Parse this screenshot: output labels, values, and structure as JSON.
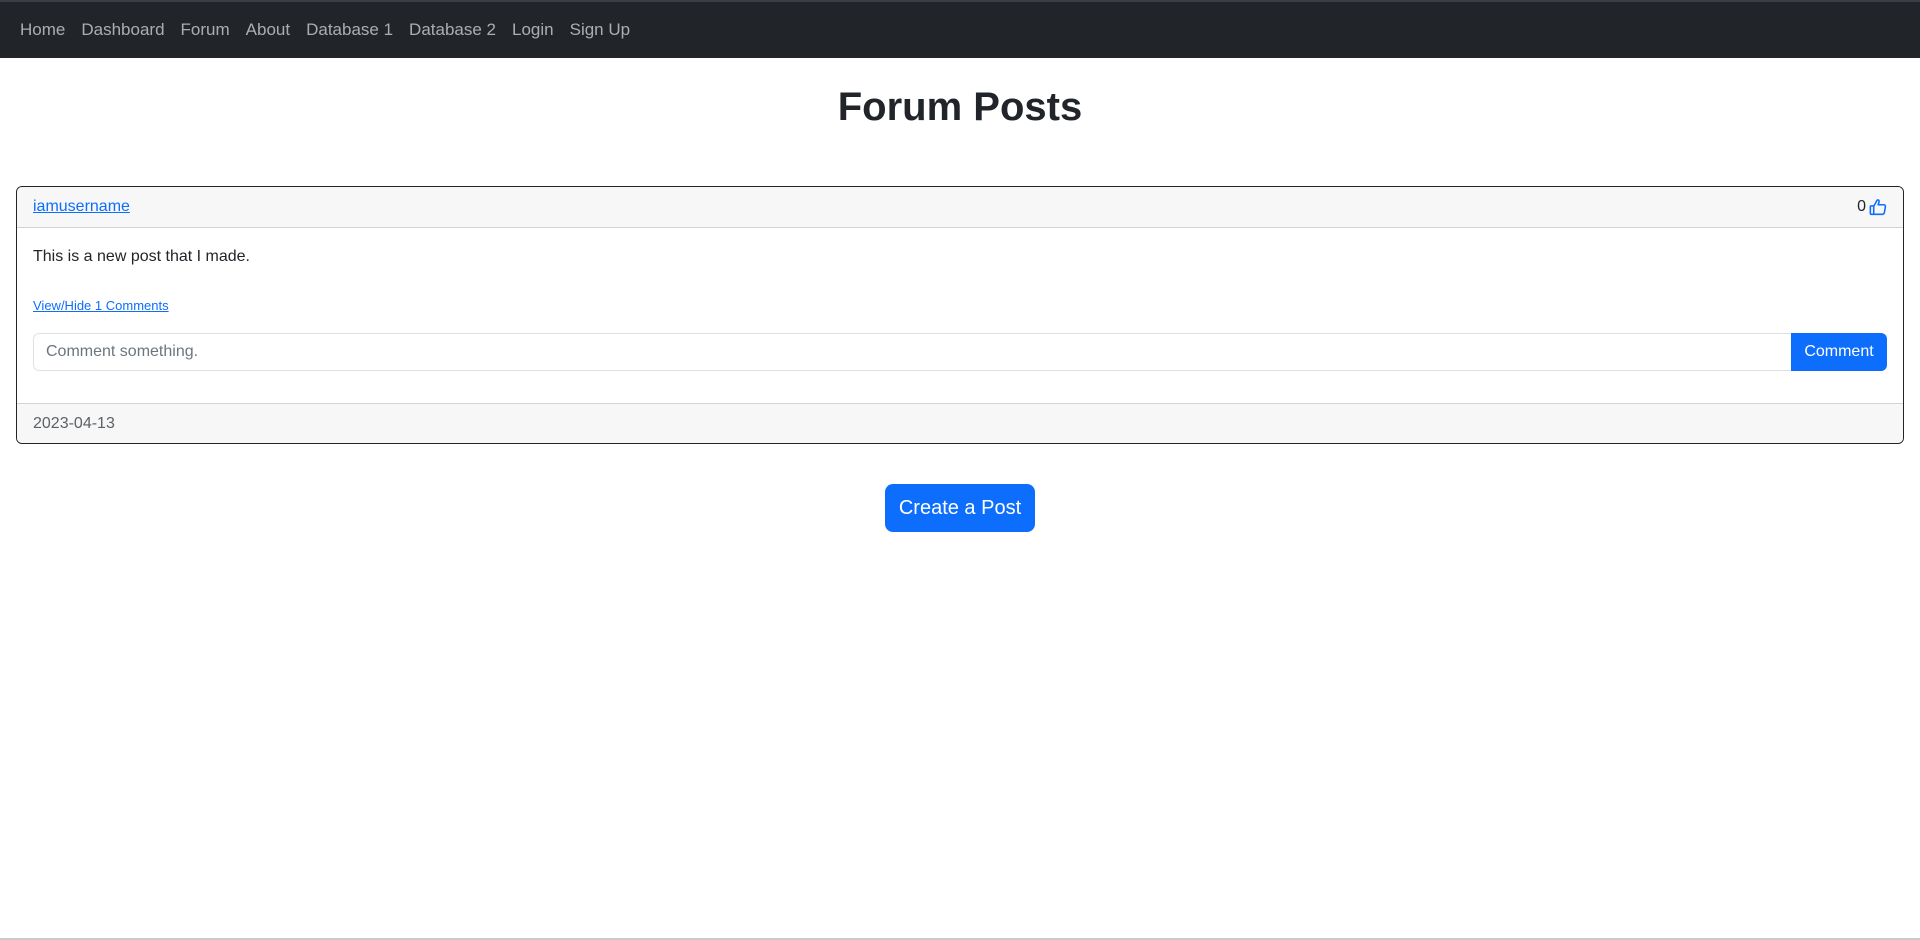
{
  "nav": {
    "items": [
      {
        "label": "Home"
      },
      {
        "label": "Dashboard"
      },
      {
        "label": "Forum"
      },
      {
        "label": "About"
      },
      {
        "label": "Database 1"
      },
      {
        "label": "Database 2"
      },
      {
        "label": "Login"
      },
      {
        "label": "Sign Up"
      }
    ]
  },
  "page": {
    "title": "Forum Posts"
  },
  "post": {
    "author": "iamusername",
    "likes": "0",
    "like_icon": "thumbs-up-icon",
    "content": "This is a new post that I made.",
    "toggle_comments_label": "View/Hide 1 Comments",
    "comment_placeholder": "Comment something.",
    "comment_button_label": "Comment",
    "date": "2023-04-13"
  },
  "actions": {
    "create_post_label": "Create a Post"
  },
  "colors": {
    "navbar_bg": "#212529",
    "primary": "#0d6efd",
    "card_header_bg": "#f7f7f7"
  }
}
